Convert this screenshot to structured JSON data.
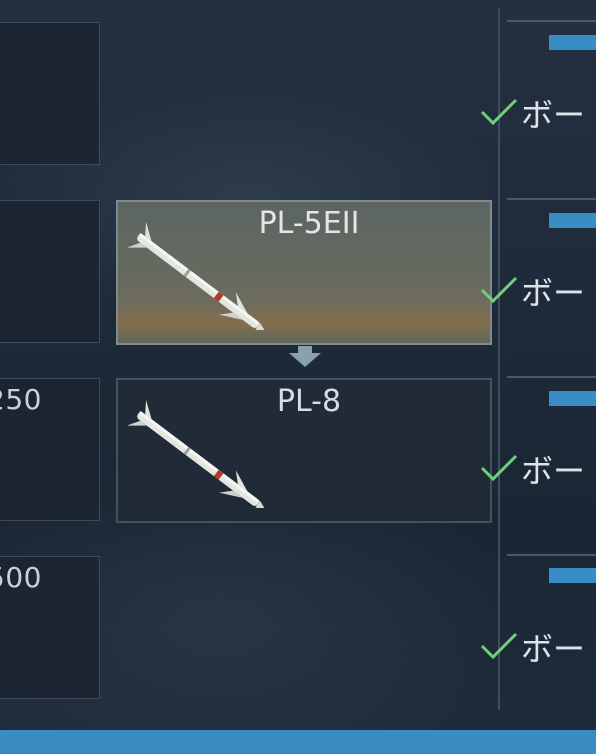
{
  "left_column": {
    "rows": [
      {
        "value": ""
      },
      {
        "value": ""
      },
      {
        "value": "250"
      },
      {
        "value": "500"
      }
    ]
  },
  "weapons": {
    "selected": {
      "name": "PL-5EII",
      "icon": "missile-icon"
    },
    "next": {
      "name": "PL-8",
      "icon": "missile-icon"
    },
    "arrow_icon": "arrow-down-icon"
  },
  "right_column": {
    "rows": [
      {
        "label": "ボー",
        "status_icon": "checkmark-icon"
      },
      {
        "label": "ボー",
        "status_icon": "checkmark-icon"
      },
      {
        "label": "ボー",
        "status_icon": "checkmark-icon"
      },
      {
        "label": "ボー",
        "status_icon": "checkmark-icon"
      }
    ]
  },
  "colors": {
    "accent_blue": "#3a8bc2",
    "check_green": "#6fd07a",
    "background": "#1f2b3a"
  }
}
